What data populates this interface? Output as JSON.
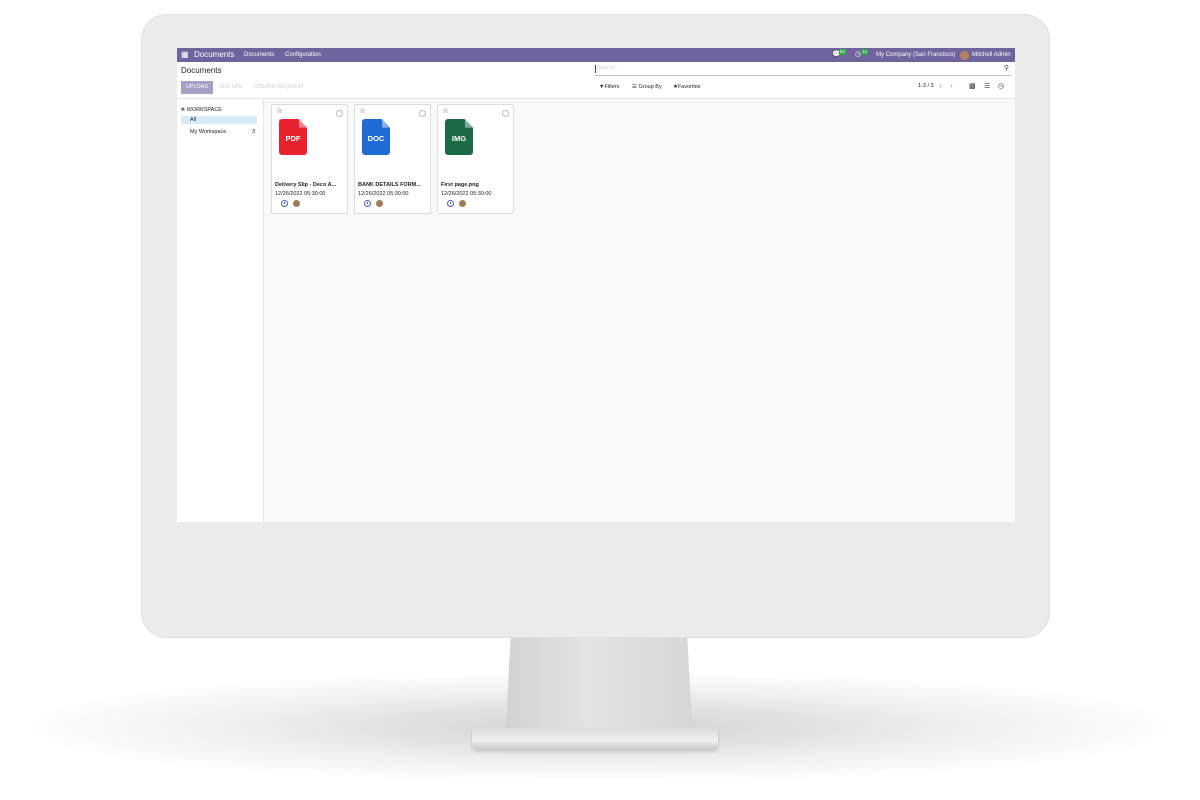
{
  "navbar": {
    "brand": "Documents",
    "menus": [
      "Documents",
      "Configuration"
    ],
    "messages_badge": "54",
    "activities_badge": "12",
    "company": "My Company (San Francisco)",
    "user": "Mitchell Admin"
  },
  "control_panel": {
    "title": "Documents",
    "search_placeholder": "Search...",
    "buttons": {
      "upload": "UPLOAD",
      "add_url": "ADD URL",
      "create_request": "CREATE REQUEST"
    },
    "filters": "Filters",
    "group_by": "Group By",
    "favorites": "Favorites",
    "pager": "1-3 / 3"
  },
  "sidebar": {
    "heading": "WORKSPACE",
    "items": [
      {
        "label": "All",
        "count": ""
      },
      {
        "label": "My Workspace",
        "count": "3"
      }
    ]
  },
  "documents": [
    {
      "type": "PDF",
      "name": "Delivery Slip - Deco A...",
      "date": "12/26/2022 05:30:00",
      "color": "#e8222f"
    },
    {
      "type": "DOC",
      "name": "BANK DETAILS FORM...",
      "date": "12/26/2022 05:30:00",
      "color": "#1f6bd6"
    },
    {
      "type": "IMG",
      "name": "First page.png",
      "date": "12/26/2022 05:30:00",
      "color": "#1c6b45"
    }
  ],
  "colors": {
    "navbar": "#71639e",
    "upload_button": "#a79fc4",
    "active_item": "#d9ebf6"
  }
}
